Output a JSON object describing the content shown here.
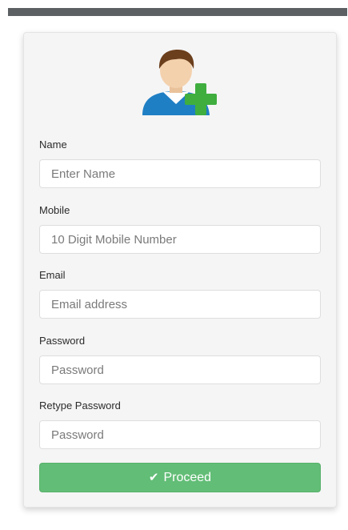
{
  "colors": {
    "top_bar": "#5c6063",
    "card_background": "#f5f5f5",
    "button_background": "#62bd76",
    "button_text": "#ffffff"
  },
  "avatar": {
    "icon": "add-user-icon"
  },
  "fields": {
    "name": {
      "label": "Name",
      "placeholder": "Enter Name"
    },
    "mobile": {
      "label": "Mobile",
      "placeholder": "10 Digit Mobile Number"
    },
    "email": {
      "label": "Email",
      "placeholder": "Email address"
    },
    "password": {
      "label": "Password",
      "placeholder": "Password"
    },
    "retype_password": {
      "label": "Retype Password",
      "placeholder": "Password"
    }
  },
  "proceed": {
    "label": "Proceed",
    "icon": "check-icon"
  }
}
